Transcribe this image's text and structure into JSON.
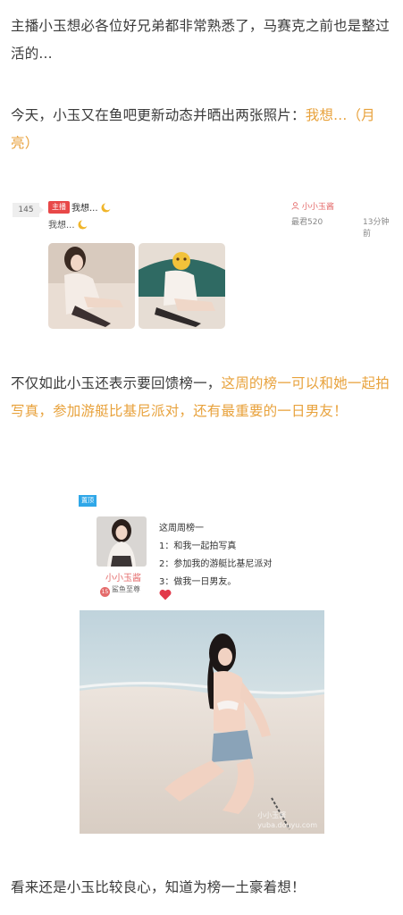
{
  "paragraphs": {
    "p1": "主播小玉想必各位好兄弟都非常熟悉了，马赛克之前也是整过活的...",
    "p2_text": "今天，小玉又在鱼吧更新动态并晒出两张照片：",
    "p2_highlight": "我想...（月亮）",
    "p3_text": "不仅如此小玉还表示要回馈榜一，",
    "p3_highlight": "这周的榜一可以和她一起拍写真，参加游艇比基尼派对，还有最重要的一日男友！",
    "p4": "看来还是小玉比较良心，知道为榜一土豪着想！"
  },
  "post": {
    "count": "145",
    "host_tag": "主播",
    "title": "我想...",
    "line2": "我想...",
    "author": "小小玉酱",
    "board": "最君520",
    "time_ago": "13分钟前"
  },
  "rank_card": {
    "corner_tag": "置顶",
    "nickname": "小小玉酱",
    "level_badge": "15",
    "level_label": "鲨鱼至尊",
    "title": "这周周榜一",
    "items": [
      "1：和我一起拍写真",
      "2：参加我的游艇比基尼派对",
      "3：做我一日男友。"
    ],
    "watermark_name": "小小玉酱",
    "watermark_site": "yuba.douyu.com"
  },
  "colors": {
    "highlight": "#e8a23c",
    "host_tag": "#e84848",
    "author": "#e46a6a",
    "corner_tag": "#2fa7e8"
  }
}
